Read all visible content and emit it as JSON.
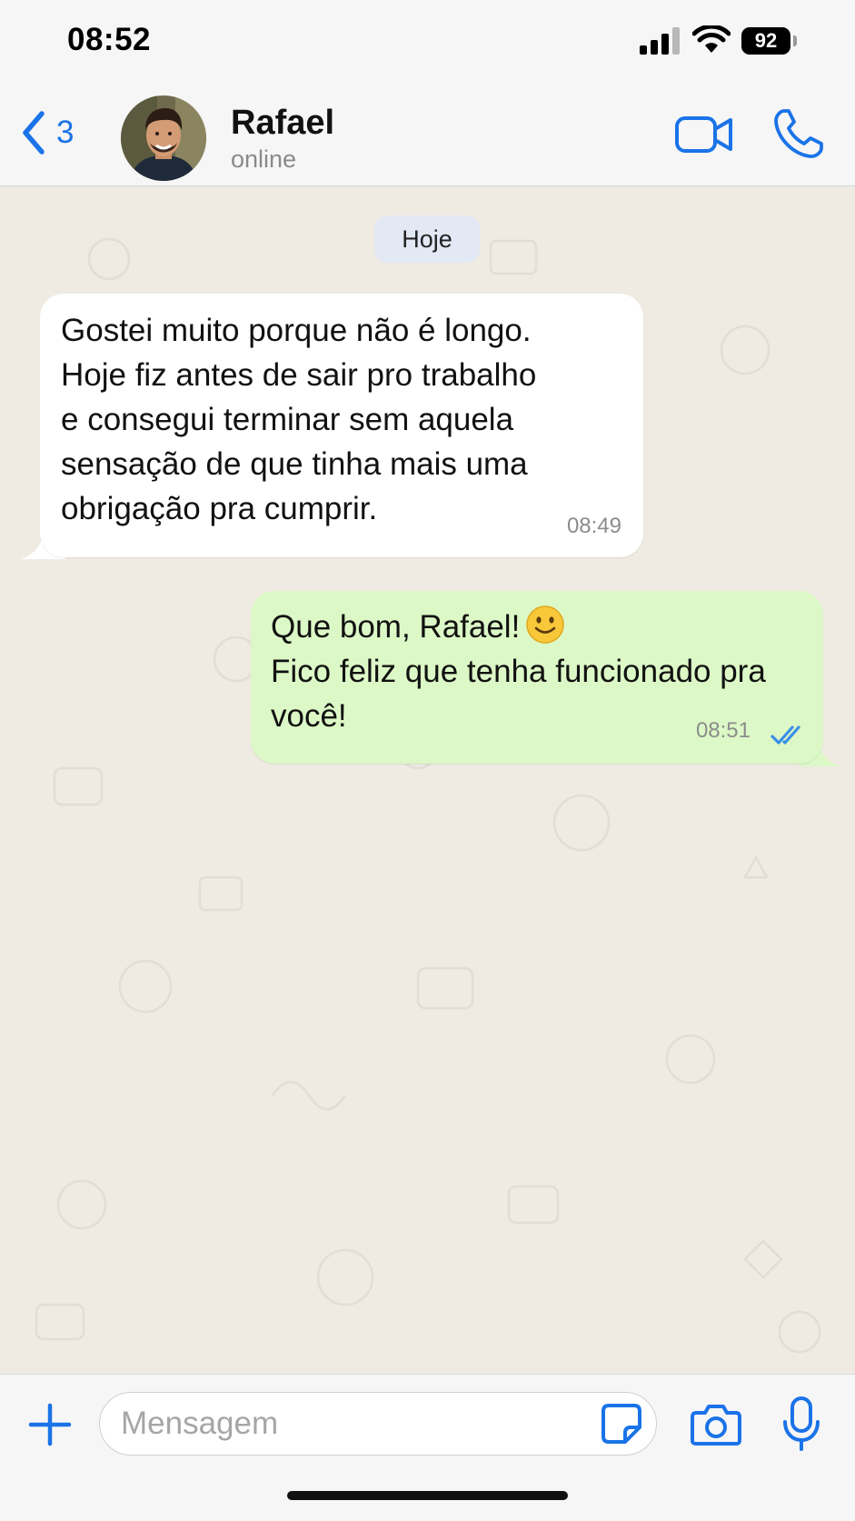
{
  "status_bar": {
    "time": "08:52",
    "battery": "92"
  },
  "header": {
    "back_count": "3",
    "contact_name": "Rafael",
    "contact_status": "online"
  },
  "chat": {
    "date_label": "Hoje",
    "messages": [
      {
        "direction": "incoming",
        "text": "Gostei muito porque não é longo.\nHoje fiz antes de sair pro trabalho\ne consegui terminar sem aquela\nsensação de que tinha mais uma\nobrigação pra cumprir.",
        "time": "08:49"
      },
      {
        "direction": "outgoing",
        "text_line1": "Que bom, Rafael!",
        "emoji": "slightly-smiling-face",
        "text_rest": "Fico feliz que tenha funcionado pra\nvocê!",
        "time": "08:51",
        "status": "read"
      }
    ]
  },
  "composer": {
    "placeholder": "Mensagem",
    "value": ""
  },
  "colors": {
    "accent": "#1a73e8",
    "outgoing_bubble": "#dcf8c6",
    "incoming_bubble": "#ffffff",
    "chat_background": "#efeae2"
  }
}
